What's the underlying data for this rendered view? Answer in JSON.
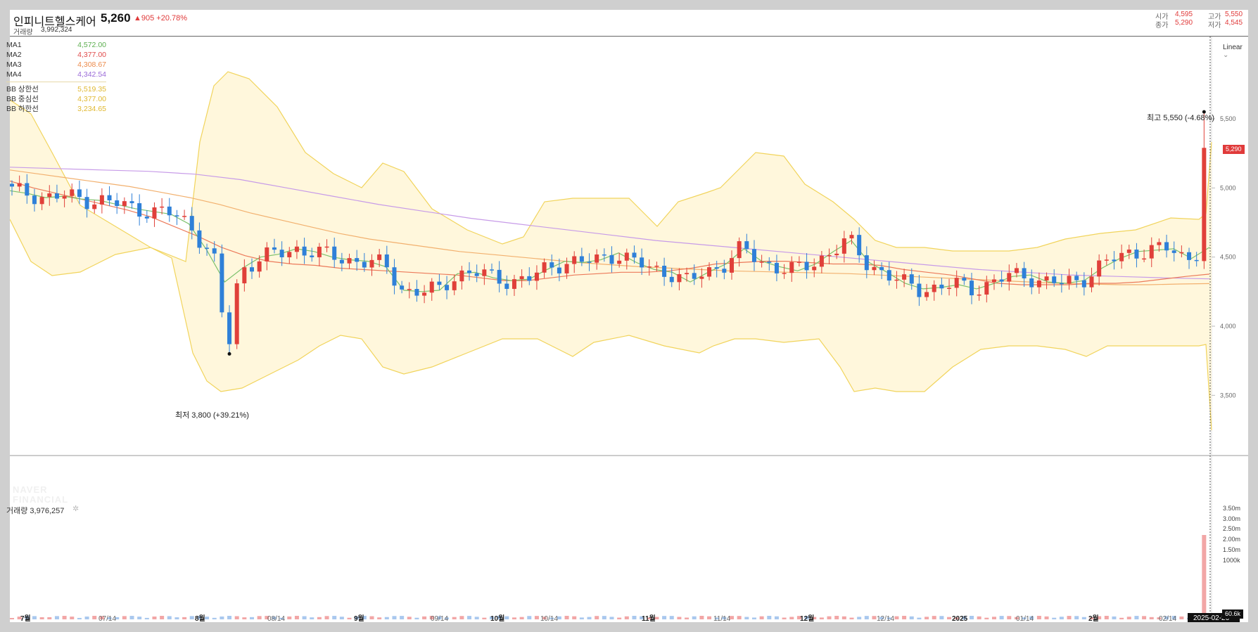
{
  "header": {
    "name": "인피니트헬스케어",
    "price": "5,260",
    "change": "▲905 +20.78%",
    "volume_label": "거래량",
    "volume_value": "3,992,324",
    "open_label": "시가",
    "open_value": "4,595",
    "high_label": "고가",
    "high_value": "5,550",
    "close_label": "종가",
    "close_value": "5,290",
    "low_label": "저가",
    "low_value": "4,545"
  },
  "legend": [
    {
      "name": "MA1",
      "value": "4,572.00",
      "color": "#5cae4f"
    },
    {
      "name": "MA2",
      "value": "4,377.00",
      "color": "#e04a4a"
    },
    {
      "name": "MA3",
      "value": "4,308.67",
      "color": "#ec8a4a"
    },
    {
      "name": "MA4",
      "value": "4,342.54",
      "color": "#9a6ad8"
    },
    {
      "name": "BB 상한선",
      "value": "5,519.35",
      "color": "#e0b830"
    },
    {
      "name": "BB 중심선",
      "value": "4,377.00",
      "color": "#e0b830"
    },
    {
      "name": "BB 하한선",
      "value": "3,234.65",
      "color": "#e0b830"
    }
  ],
  "scale_mode": "Linear",
  "watermark": [
    "NAVER",
    "FINANCIAL"
  ],
  "volume_pane": {
    "label": "거래량 3,976,257",
    "gear": "✲"
  },
  "annotations": {
    "low": "최저 3,800 (+39.21%)",
    "high": "최고 5,550 (-4.68%)",
    "current_price_tag": "5,290",
    "volume_tag": "60.6k",
    "date_tag": "2025-02-26"
  },
  "colors": {
    "up": "#e0403a",
    "down": "#2f80d8",
    "bb_fill": "#fff7dc",
    "bb_line": "#f1d45c"
  },
  "chart_data": {
    "type": "candlestick",
    "title": "인피니트헬스케어",
    "y_ticks": [
      "3,500",
      "4,000",
      "4,500",
      "5,000",
      "5,500"
    ],
    "ylim": [
      3200,
      5600
    ],
    "volume_ticks": [
      "1000k",
      "1.50m",
      "2.00m",
      "2.50m",
      "3.00m",
      "3.50m"
    ],
    "x_ticks": [
      "7월",
      "07/14",
      "8월",
      "08/14",
      "9월",
      "09/14",
      "10월",
      "10/14",
      "11월",
      "11/14",
      "12월",
      "12/14",
      "2025",
      "01/14",
      "2월",
      "02/14"
    ],
    "series": [
      {
        "name": "MA1",
        "values": [
          4980,
          4960,
          4930,
          4940,
          4920,
          4910,
          4880,
          4850,
          4830,
          4810,
          4740,
          4550,
          4320,
          4420,
          4500,
          4520,
          4560,
          4540,
          4500,
          4480,
          4470,
          4430,
          4260,
          4250,
          4260,
          4380,
          4390,
          4350,
          4330,
          4340,
          4410,
          4470,
          4460,
          4480,
          4530,
          4460,
          4410,
          4390,
          4320,
          4390,
          4450,
          4560,
          4470,
          4430,
          4400,
          4450,
          4540,
          4620,
          4460,
          4390,
          4310,
          4270,
          4280,
          4300,
          4270,
          4310,
          4360,
          4370,
          4320,
          4310,
          4330,
          4420,
          4490,
          4540,
          4550,
          4560,
          4490,
          4570
        ]
      },
      {
        "name": "MA2",
        "values": [
          5050,
          5000,
          4960,
          4920,
          4880,
          4840,
          4790,
          4720,
          4650,
          4570,
          4510,
          4470,
          4450,
          4440,
          4420,
          4410,
          4400,
          4390,
          4380,
          4370,
          4350,
          4330,
          4330,
          4350,
          4370,
          4380,
          4390,
          4390,
          4400,
          4420,
          4450,
          4460,
          4470,
          4470,
          4460,
          4450,
          4450,
          4440,
          4410,
          4390,
          4370,
          4340,
          4310,
          4300,
          4300,
          4300,
          4310,
          4310,
          4320,
          4340,
          4360,
          4377
        ]
      },
      {
        "name": "MA3",
        "values": [
          5130,
          5100,
          5070,
          5040,
          5010,
          4970,
          4930,
          4880,
          4820,
          4770,
          4720,
          4670,
          4630,
          4600,
          4570,
          4540,
          4520,
          4500,
          4480,
          4460,
          4445,
          4430,
          4420,
          4410,
          4400,
          4395,
          4390,
          4385,
          4380,
          4370,
          4360,
          4350,
          4340,
          4330,
          4320,
          4310,
          4305,
          4300,
          4300,
          4305,
          4308
        ]
      },
      {
        "name": "MA4",
        "values": [
          5150,
          5140,
          5130,
          5120,
          5100,
          5060,
          5000,
          4940,
          4880,
          4830,
          4780,
          4740,
          4700,
          4660,
          4620,
          4590,
          4560,
          4530,
          4500,
          4470,
          4440,
          4410,
          4390,
          4370,
          4360,
          4350,
          4342
        ]
      }
    ],
    "low_point": 3800,
    "high_point": 5550,
    "last_close": 5290
  }
}
